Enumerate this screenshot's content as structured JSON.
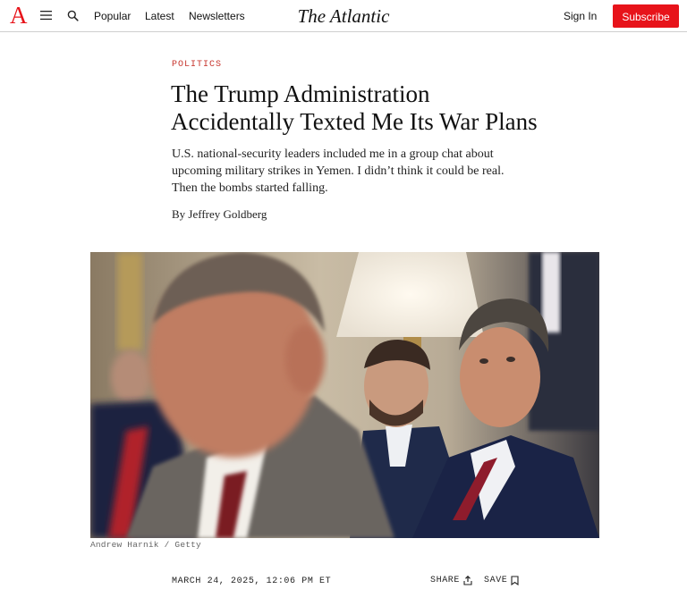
{
  "header": {
    "logo_letter": "A",
    "nav": {
      "popular": "Popular",
      "latest": "Latest",
      "newsletters": "Newsletters"
    },
    "brand": "The Atlantic",
    "sign_in": "Sign In",
    "subscribe": "Subscribe",
    "icons": [
      "menu-icon",
      "search-icon"
    ],
    "accent_color": "#e7131a"
  },
  "article": {
    "kicker": "POLITICS",
    "headline": "The Trump Administration Accidentally Texted Me Its War Plans",
    "dek": "U.S. national-security leaders included me in a group chat about upcoming military strikes in Yemen. I didn’t think it could be real. Then the bombs started falling.",
    "byline_prefix": "By",
    "author": "Jeffrey Goldberg",
    "photo_credit": "Andrew Harnik / Getty",
    "date": "MARCH 24, 2025, 12:06 PM ET",
    "share_label": "SHARE",
    "save_label": "SAVE",
    "kicker_color": "#c7342c"
  }
}
